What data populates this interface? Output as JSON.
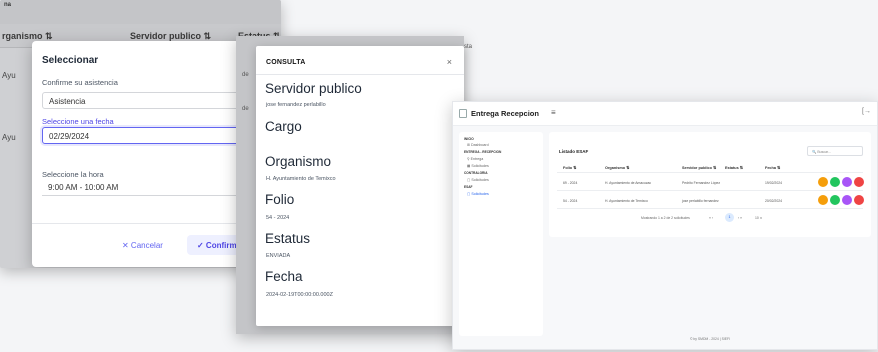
{
  "back_window": {
    "top_label": "na",
    "columns": [
      "rganismo ⇅",
      "Servidor publico ⇅",
      "Estatus ⇅"
    ],
    "row_fragments": [
      "Ayu",
      "Ayu"
    ],
    "dialog": {
      "title": "Seleccionar",
      "attendance_label": "Confirme su asistencia",
      "attendance_value": "Asistencia",
      "date_label": "Seleccione una fecha",
      "date_value": "02/29/2024",
      "time_label": "Seleccione la hora",
      "time_value": "9:00 AM - 10:00 AM",
      "cancel_label": "✕ Cancelar",
      "confirm_label": "✓ Confirmar"
    }
  },
  "consulta": {
    "edge_labels": [
      "de",
      "de",
      "sta"
    ],
    "header": "CONSULTA",
    "close": "×",
    "fields": [
      {
        "label": "Servidor publico",
        "value": "jose fernandez perlabillo"
      },
      {
        "label": "Cargo",
        "value": ""
      },
      {
        "label": "Organismo",
        "value": "H. Ayuntamiento de Temixco"
      },
      {
        "label": "Folio",
        "value": "54 - 2024"
      },
      {
        "label": "Estatus",
        "value": "ENVIADA"
      },
      {
        "label": "Fecha",
        "value": "2024-02-19T00:00:00.000Z"
      }
    ]
  },
  "app": {
    "brand": "Entrega Recepcion",
    "hamburger": "≡",
    "logout": "[→",
    "sidebar": [
      {
        "type": "section",
        "label": "INICIO"
      },
      {
        "type": "item",
        "label": "⊞ Dashboard"
      },
      {
        "type": "section",
        "label": "ENTREGA - RECEPCION"
      },
      {
        "type": "item",
        "label": "⚲ Entrega"
      },
      {
        "type": "item",
        "label": "▦ Solicitudes"
      },
      {
        "type": "section",
        "label": "CONTRALORIA"
      },
      {
        "type": "item",
        "label": "▢ Solicitudes"
      },
      {
        "type": "section",
        "label": "ESAF"
      },
      {
        "type": "item",
        "label": "▢ Solicitudes",
        "active": true
      }
    ],
    "table": {
      "title": "Listado ESAF",
      "search_placeholder": "🔍 Buscar...",
      "headers": [
        "Folio ⇅",
        "Organismo ⇅",
        "Servidor publico ⇅",
        "Estatus ⇅",
        "Fecha ⇅"
      ],
      "rows": [
        [
          "69 - 2024",
          "H. Ayuntamiento de Amacuzac",
          "Pedrito Fernandez López",
          "",
          "19/02/2024"
        ],
        [
          "54 - 2024",
          "H. Ayuntamiento de Temixco",
          "jose perlabillo fernandez",
          "",
          "20/02/2024"
        ]
      ],
      "action_colors": [
        "#f59e0b",
        "#22c55e",
        "#a855f7",
        "#ef4444"
      ],
      "pagination_info": "Mostrando 1 a 2 de 2 solicitudes",
      "pagination_prev": "«  ‹",
      "pagination_current": "1",
      "pagination_next": "›  »",
      "page_size": "10 ∨"
    },
    "footer": "© by SMDM - 2024 | SIEFI"
  }
}
